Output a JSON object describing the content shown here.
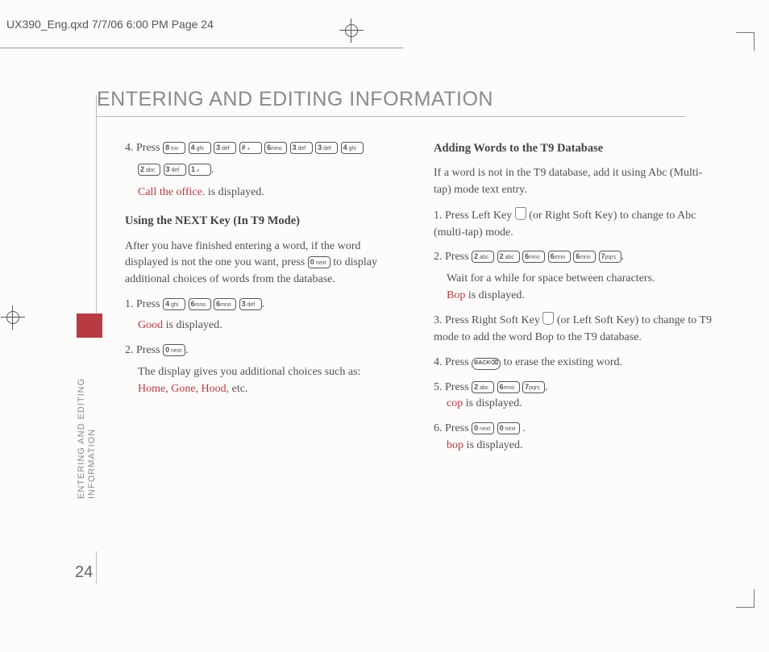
{
  "header": "UX390_Eng.qxd  7/7/06  6:00 PM  Page 24",
  "title": "ENTERING AND EDITING INFORMATION",
  "sideLabel": "ENTERING AND EDITING\nINFORMATION",
  "pageNumber": "24",
  "left": {
    "step4_prefix": "4. Press ",
    "step4_keys_a": [
      "8 tuv",
      "4 ghi",
      "3 def",
      "# ⁎",
      "6mno",
      "3 def",
      "3 def",
      "4 ghi"
    ],
    "step4_keys_b": [
      "2 abc",
      "3 def",
      "1 ⁎"
    ],
    "step4_result_red": "Call the office.",
    "step4_result_tail": " is displayed.",
    "nextHead": "Using the NEXT Key (In T9 Mode)",
    "nextPara_a": "After you have finished entering a word, if the word displayed is not the one you want, press ",
    "nextPara_key": "0 next",
    "nextPara_b": " to display additional choices of words from the database.",
    "n1_prefix": "1. Press ",
    "n1_keys": [
      "4 ghi",
      "6mno",
      "6mno",
      "3 def"
    ],
    "n1_result_red": "Good",
    "n1_result_tail": " is displayed.",
    "n2_prefix": "2. Press ",
    "n2_key": "0 next",
    "n2_resultA": "The display gives you additional choices such as:",
    "n2_result_red": "Home, Gone, Hood,",
    "n2_result_tail": " etc."
  },
  "right": {
    "addHead": "Adding Words to the T9 Database",
    "addPara": "If a word is not in the T9 database, add it using Abc (Multi-tap) mode text entry.",
    "r1_a": "1. Press Left Key ",
    "r1_b": " (or Right Soft Key) to change to Abc (multi-tap) mode.",
    "r2_prefix": "2. Press ",
    "r2_keys": [
      "2 abc",
      "2 abc",
      "6mno",
      "6mno",
      "6mno",
      "7pqrs"
    ],
    "r2_wait": "Wait for a while for space between characters.",
    "r2_red": "Bop",
    "r2_tail": " is displayed.",
    "r3_a": "3. Press Right Soft Key ",
    "r3_b": " (or Left Soft Key) to change to T9 mode to add the word Bop to the T9 database.",
    "r4_a": "4. Press ",
    "r4_key": "BACK⌫",
    "r4_b": " to erase the existing word.",
    "r5_prefix": "5. Press ",
    "r5_keys": [
      "2 abc",
      "6mno",
      "7pqrs"
    ],
    "r5_red": "cop",
    "r5_tail": " is displayed.",
    "r6_prefix": "6. Press ",
    "r6_keys": [
      "0 next",
      "0 next"
    ],
    "r6_red": "bop",
    "r6_tail": " is displayed."
  }
}
